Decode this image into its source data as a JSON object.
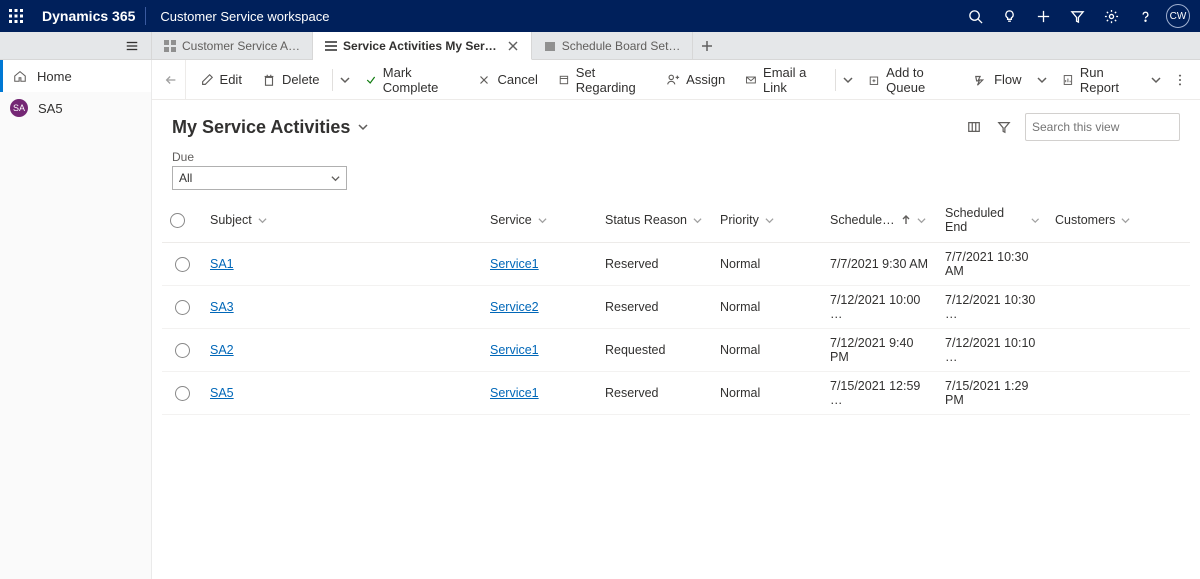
{
  "topbar": {
    "brand": "Dynamics 365",
    "workspace": "Customer Service workspace",
    "avatar": "CW"
  },
  "tabs": [
    {
      "label": "Customer Service A…",
      "active": false,
      "closeable": false
    },
    {
      "label": "Service Activities My Ser…",
      "active": true,
      "closeable": true
    },
    {
      "label": "Schedule Board Set…",
      "active": false,
      "closeable": false
    }
  ],
  "sidebar": {
    "home": "Home",
    "record_badge": "SA",
    "record_label": "SA5"
  },
  "commands": {
    "edit": "Edit",
    "delete": "Delete",
    "mark_complete": "Mark Complete",
    "cancel": "Cancel",
    "set_regarding": "Set Regarding",
    "assign": "Assign",
    "email_link": "Email a Link",
    "add_to_queue": "Add to Queue",
    "flow": "Flow",
    "run_report": "Run Report"
  },
  "view": {
    "title": "My Service Activities",
    "due_label": "Due",
    "due_value": "All",
    "search_placeholder": "Search this view"
  },
  "columns": {
    "subject": "Subject",
    "service": "Service",
    "status": "Status Reason",
    "priority": "Priority",
    "start": "Schedule…",
    "end": "Scheduled End",
    "customers": "Customers"
  },
  "rows": [
    {
      "subject": "SA1",
      "service": "Service1",
      "status": "Reserved",
      "priority": "Normal",
      "start": "7/7/2021 9:30 AM",
      "end": "7/7/2021 10:30 AM",
      "customers": ""
    },
    {
      "subject": "SA3",
      "service": "Service2",
      "status": "Reserved",
      "priority": "Normal",
      "start": "7/12/2021 10:00 …",
      "end": "7/12/2021 10:30 …",
      "customers": ""
    },
    {
      "subject": "SA2",
      "service": "Service1",
      "status": "Requested",
      "priority": "Normal",
      "start": "7/12/2021 9:40 PM",
      "end": "7/12/2021 10:10 …",
      "customers": ""
    },
    {
      "subject": "SA5",
      "service": "Service1",
      "status": "Reserved",
      "priority": "Normal",
      "start": "7/15/2021 12:59 …",
      "end": "7/15/2021 1:29 PM",
      "customers": ""
    }
  ]
}
